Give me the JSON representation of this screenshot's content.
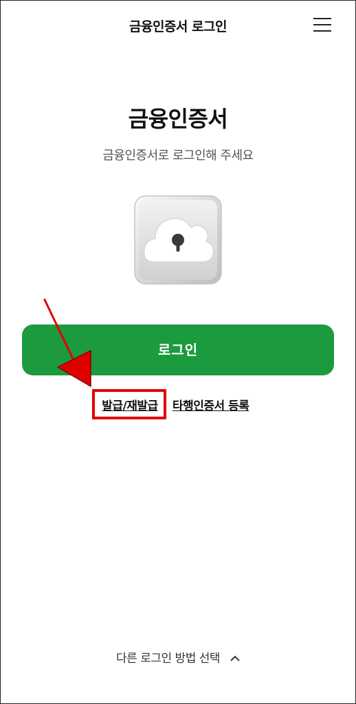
{
  "header": {
    "title": "금융인증서 로그인",
    "menu_icon": "hamburger-menu-icon"
  },
  "main": {
    "title": "금융인증서",
    "subtitle": "금융인증서로 로그인해 주세요",
    "cert_icon": "cloud-keyhole-icon"
  },
  "login_button": {
    "label": "로그인",
    "color": "#1b9a3e"
  },
  "links": {
    "issue_label": "발급/재발급",
    "other_bank_label": "타행인증서 등록"
  },
  "footer": {
    "other_login_label": "다른 로그인 방법 선택",
    "chevron_icon": "chevron-up-icon"
  },
  "annotation": {
    "highlight_color": "#e00000",
    "arrow_icon": "red-arrow-icon"
  }
}
